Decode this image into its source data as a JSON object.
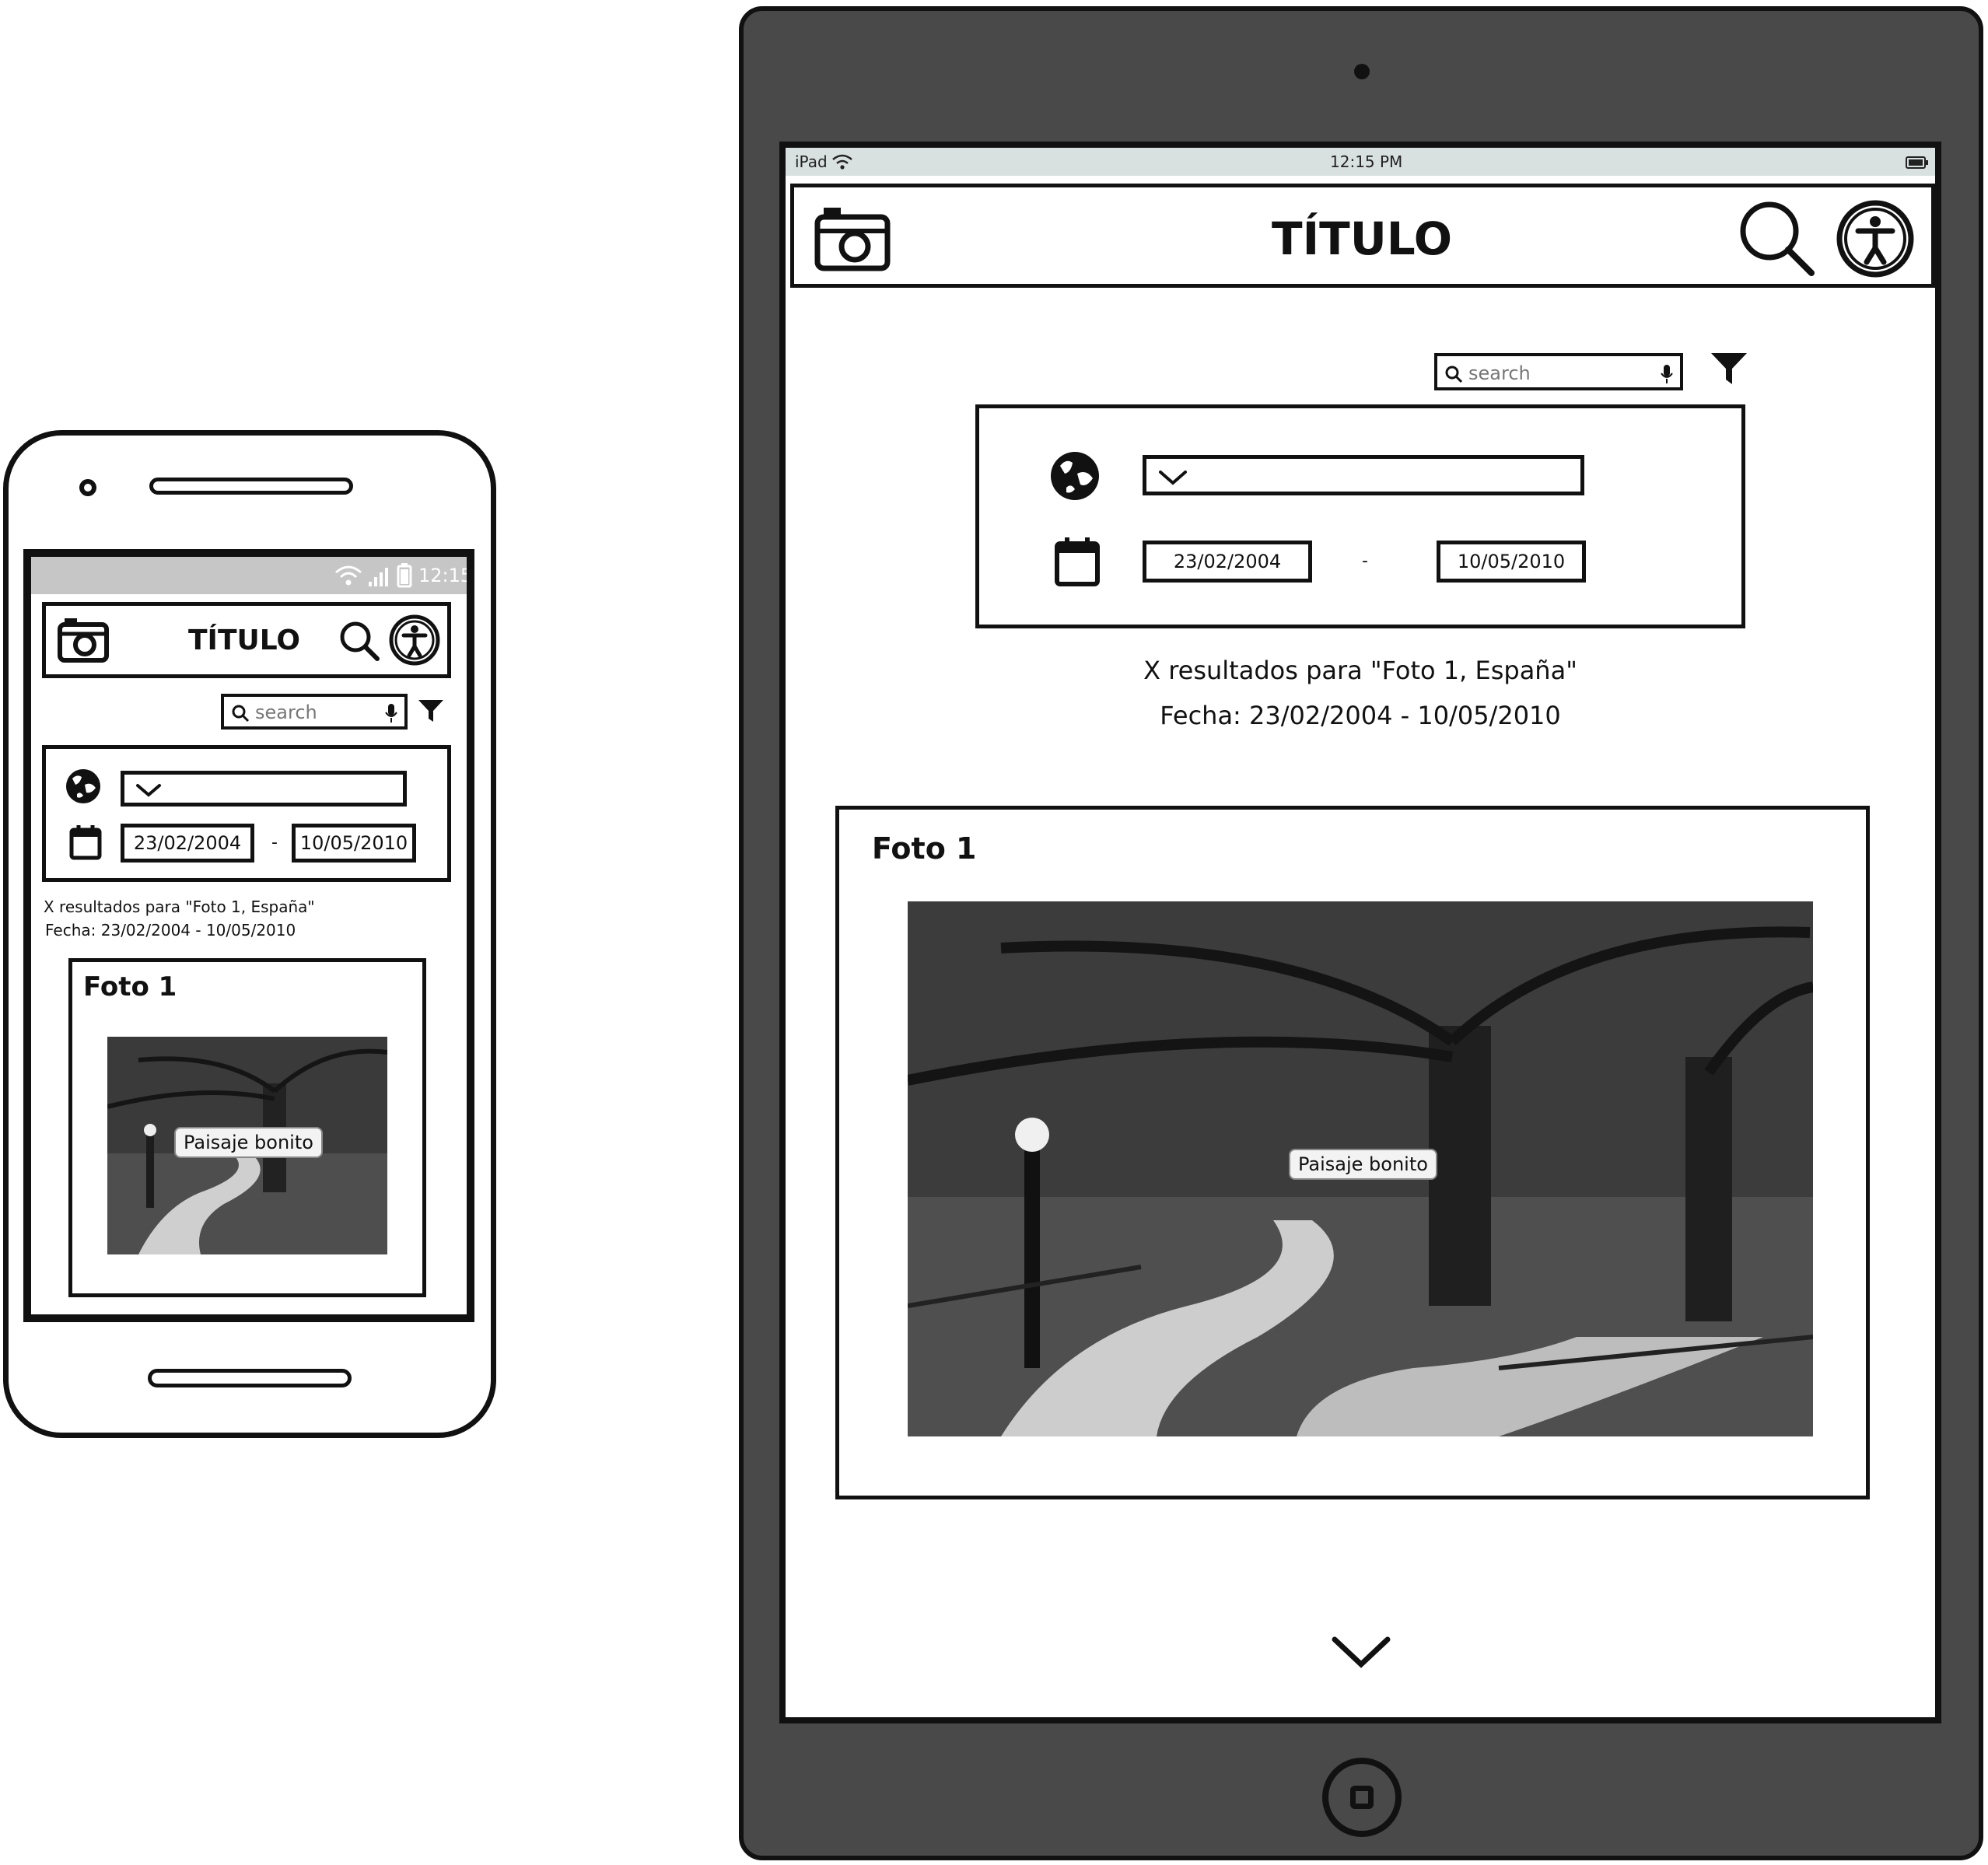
{
  "phone": {
    "status_time": "12:15",
    "header_title": "TÍTULO",
    "search_placeholder": "search",
    "date_from": "23/02/2004",
    "date_separator": "-",
    "date_to": "10/05/2010",
    "results_line": "X resultados para \"Foto 1, España\"",
    "date_line": "Fecha: 23/02/2004 - 10/05/2010",
    "card_title": "Foto 1",
    "photo_label": "Paisaje bonito"
  },
  "tablet": {
    "status_device": "iPad",
    "status_time": "12:15 PM",
    "header_title": "TÍTULO",
    "search_placeholder": "search",
    "date_from": "23/02/2004",
    "date_separator": "-",
    "date_to": "10/05/2010",
    "results_line": "X resultados para \"Foto 1, España\"",
    "date_line": "Fecha: 23/02/2004 - 10/05/2010",
    "card_title": "Foto 1",
    "photo_label": "Paisaje bonito"
  },
  "icons": {
    "camera": "camera-icon",
    "search": "search-icon",
    "accessibility": "accessibility-icon",
    "filter": "filter-icon",
    "globe": "globe-icon",
    "calendar": "calendar-icon",
    "microphone": "microphone-icon",
    "dropdown": "chevron-down-icon",
    "wifi": "wifi-icon",
    "battery": "battery-icon",
    "signal": "signal-icon",
    "home": "home-button-icon"
  }
}
